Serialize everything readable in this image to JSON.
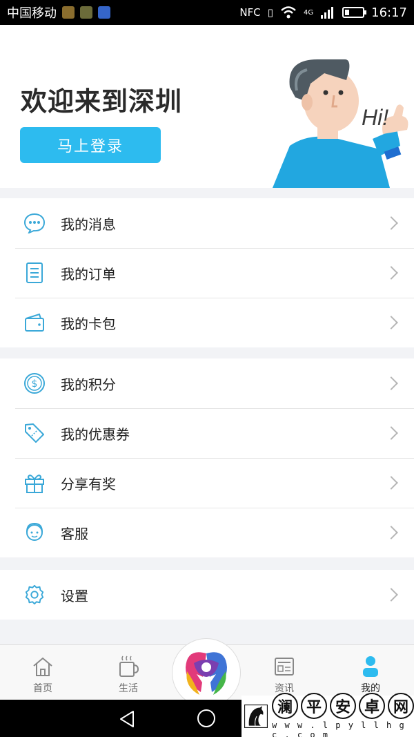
{
  "status_bar": {
    "carrier": "中国移动",
    "nfc": "NFC",
    "network": "4G",
    "time": "16:17",
    "battery_level": 0.25
  },
  "header": {
    "welcome_title": "欢迎来到深圳",
    "login_button": "马上登录",
    "illustration_text": "Hi!"
  },
  "menu_group_1": [
    {
      "label": "我的消息",
      "icon": "message-icon"
    },
    {
      "label": "我的订单",
      "icon": "order-icon"
    },
    {
      "label": "我的卡包",
      "icon": "wallet-icon"
    }
  ],
  "menu_group_2": [
    {
      "label": "我的积分",
      "icon": "points-icon"
    },
    {
      "label": "我的优惠券",
      "icon": "coupon-icon"
    },
    {
      "label": "分享有奖",
      "icon": "gift-icon"
    },
    {
      "label": "客服",
      "icon": "customer-service-icon"
    }
  ],
  "menu_group_3": [
    {
      "label": "设置",
      "icon": "gear-icon"
    }
  ],
  "tabbar": {
    "tabs": [
      {
        "label": "首页",
        "icon": "home-icon"
      },
      {
        "label": "生活",
        "icon": "coffee-icon"
      },
      {
        "label": "资讯",
        "icon": "news-icon"
      },
      {
        "label": "我的",
        "icon": "user-icon"
      }
    ],
    "active_tab": "我的"
  },
  "watermark": {
    "chars": [
      "澜",
      "平",
      "安",
      "卓",
      "网"
    ],
    "url": "w w w . l p y l l h g c . c o m"
  },
  "colors": {
    "accent": "#2dbbef",
    "icon_blue": "#3aa8d8"
  }
}
